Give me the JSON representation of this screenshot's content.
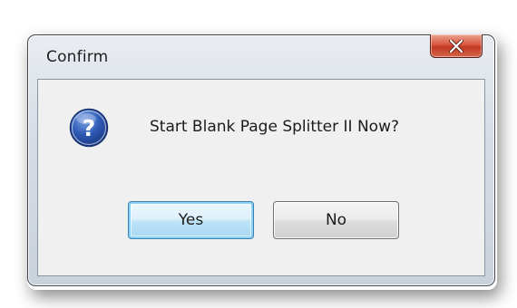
{
  "window": {
    "title": "Confirm",
    "close_icon": "close-x-icon"
  },
  "dialog": {
    "icon": "question-icon",
    "message": "Start Blank Page Splitter II Now?"
  },
  "buttons": {
    "yes_label": "Yes",
    "no_label": "No"
  },
  "colors": {
    "close_button": "#c94a33",
    "default_button_border": "#3c7fb1",
    "question_icon": "#2a4f9a"
  }
}
